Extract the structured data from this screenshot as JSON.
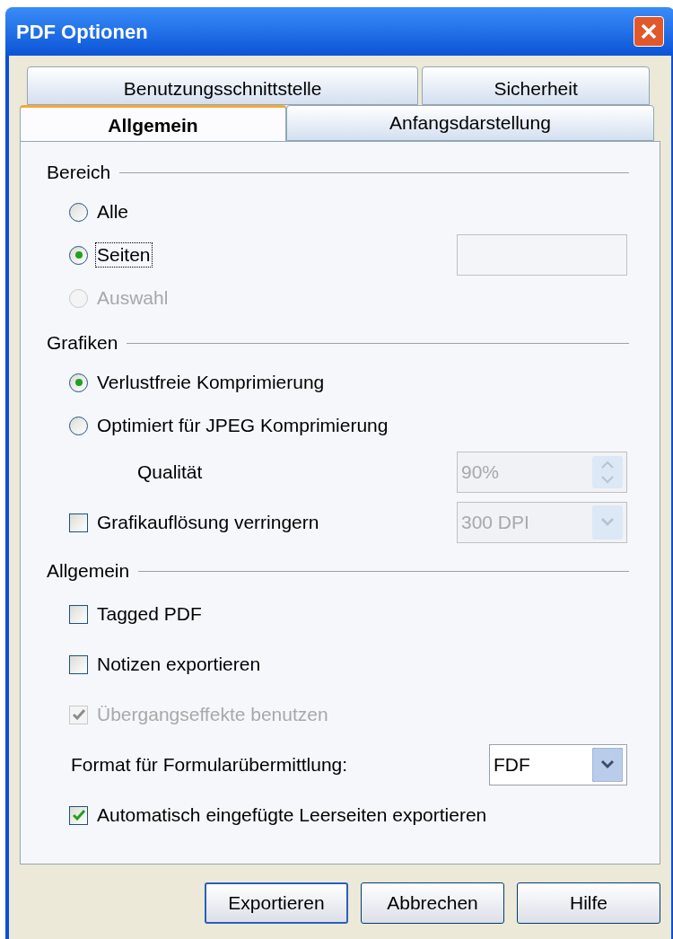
{
  "window": {
    "title": "PDF Optionen"
  },
  "tabs": [
    [
      {
        "label": "Benutzungsschnittstelle",
        "selected": false
      },
      {
        "label": "Sicherheit",
        "selected": false
      }
    ],
    [
      {
        "label": "Allgemein",
        "selected": true
      },
      {
        "label": "Anfangsdarstellung",
        "selected": false
      }
    ]
  ],
  "sections": [
    {
      "heading": "Bereich",
      "items": [
        {
          "kind": "radio",
          "label": "Alle",
          "selected": false,
          "disabled": false,
          "focused": false
        },
        {
          "kind": "radio_field",
          "label": "Seiten",
          "selected": true,
          "disabled": false,
          "focused": true
        },
        {
          "kind": "radio",
          "label": "Auswahl",
          "selected": false,
          "disabled": true,
          "focused": false
        }
      ]
    },
    {
      "heading": "Grafiken",
      "items": [
        {
          "kind": "radio",
          "label": "Verlustfreie Komprimierung",
          "selected": true,
          "disabled": false,
          "focused": false
        },
        {
          "kind": "radio",
          "label": "Optimiert für JPEG Komprimierung",
          "selected": false,
          "disabled": false,
          "focused": false
        },
        {
          "kind": "spin",
          "label": "Qualität",
          "value": "90%",
          "disabled": true
        },
        {
          "kind": "checkbox_select",
          "label": "Grafikauflösung verringern",
          "checked": false,
          "disabled": false,
          "value": "300 DPI",
          "select_disabled": true
        }
      ]
    },
    {
      "heading": "Allgemein",
      "items": [
        {
          "kind": "checkbox",
          "label": "Tagged PDF",
          "checked": false,
          "disabled": false
        },
        {
          "kind": "checkbox",
          "label": "Notizen exportieren",
          "checked": false,
          "disabled": false
        },
        {
          "kind": "checkbox",
          "label": "Übergangseffekte benutzen",
          "checked": true,
          "disabled": true
        },
        {
          "kind": "select",
          "label": "Format für Formularübermittlung:",
          "value": "FDF",
          "disabled": false
        },
        {
          "kind": "checkbox",
          "label": "Automatisch eingefügte Leerseiten exportieren",
          "checked": true,
          "disabled": false
        }
      ]
    }
  ],
  "buttons": [
    {
      "label": "Exportieren",
      "default": true
    },
    {
      "label": "Abbrechen",
      "default": false
    },
    {
      "label": "Hilfe",
      "default": false
    }
  ]
}
